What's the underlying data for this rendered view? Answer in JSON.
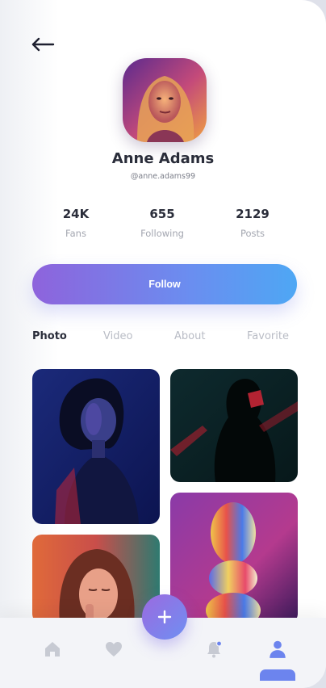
{
  "profile": {
    "name": "Anne Adams",
    "handle": "@anne.adams99"
  },
  "stats": [
    {
      "value": "24K",
      "label": "Fans"
    },
    {
      "value": "655",
      "label": "Following"
    },
    {
      "value": "2129",
      "label": "Posts"
    }
  ],
  "follow_label": "Follow",
  "tabs": [
    "Photo",
    "Video",
    "About",
    "Favorite"
  ],
  "active_tab": "Photo",
  "nav": {
    "items": [
      "home-icon",
      "heart-icon",
      "bell-icon",
      "user-icon"
    ],
    "active": "user-icon"
  },
  "colors": {
    "accent_start": "#8e63dc",
    "accent_end": "#4ea7f4",
    "text_dark": "#2a2d3a",
    "text_muted": "#a3a6b0"
  }
}
